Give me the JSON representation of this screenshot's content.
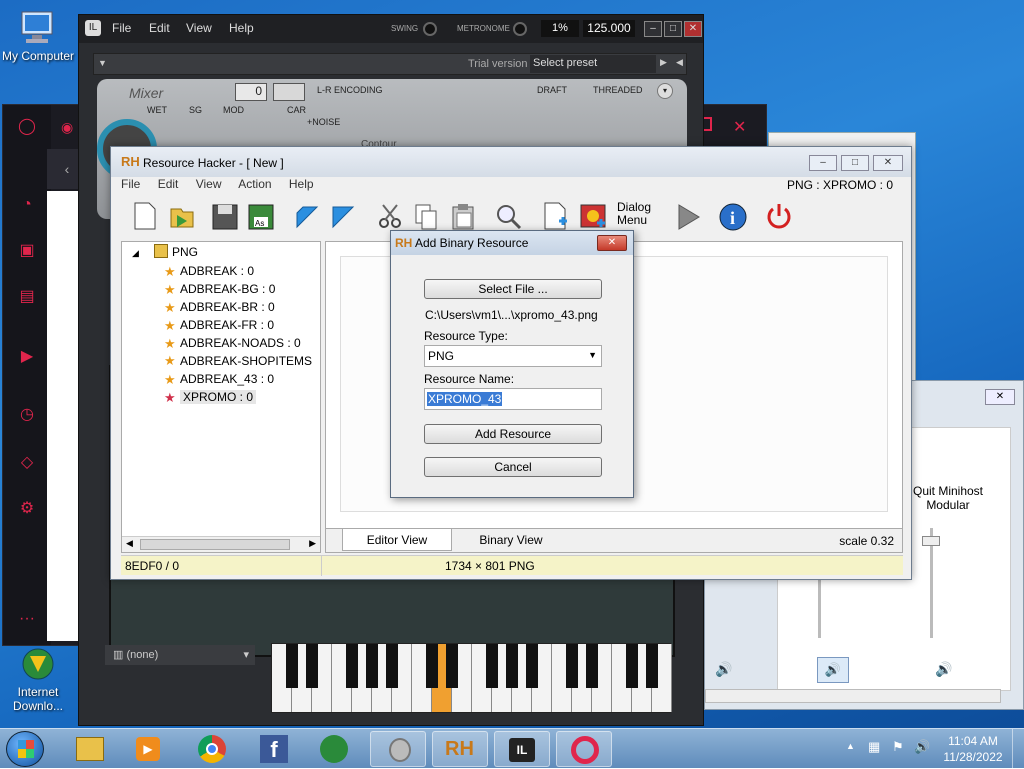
{
  "desktop": {
    "icons": [
      {
        "label": "My Computer"
      },
      {
        "label": "Internet Downlo..."
      }
    ]
  },
  "minihost": {
    "menu": [
      "File",
      "Edit",
      "View",
      "Help"
    ],
    "swing_label": "SWING",
    "metronome_label": "METRONOME",
    "percent": "1%",
    "tempo": "125.000",
    "trial_label": "Trial version",
    "preset_placeholder": "Select preset",
    "mixer_title": "Mixer",
    "wet": "WET",
    "sg": "SG",
    "mod": "MOD",
    "car": "CAR",
    "noise": "+NOISE",
    "mixer_value": "0",
    "lr_encoding": "L-R ENCODING",
    "draft": "DRAFT",
    "threaded": "THREADED",
    "contour": "Contour",
    "instrument_select": "(none)"
  },
  "minihost_side": {
    "quit_label": "Quit Minihost Modular"
  },
  "resource_hacker": {
    "title": "Resource Hacker - [ New ]",
    "menu": [
      "File",
      "Edit",
      "View",
      "Action",
      "Help"
    ],
    "current_resource": "PNG : XPROMO : 0",
    "dialog_menu_label_1": "Dialog",
    "dialog_menu_label_2": "Menu",
    "tree_root": "PNG",
    "tree_items": [
      {
        "label": "ADBREAK : 0"
      },
      {
        "label": "ADBREAK-BG : 0"
      },
      {
        "label": "ADBREAK-BR : 0"
      },
      {
        "label": "ADBREAK-FR : 0"
      },
      {
        "label": "ADBREAK-NOADS : 0"
      },
      {
        "label": "ADBREAK-SHOPITEMS"
      },
      {
        "label": "ADBREAK_43 : 0"
      },
      {
        "label": "XPROMO : 0"
      }
    ],
    "tab_editor": "Editor View",
    "tab_binary": "Binary View",
    "scale": "scale 0.32",
    "status_left": "8EDF0 / 0",
    "status_right": "1734 × 801  PNG"
  },
  "dialog": {
    "title": "Add Binary Resource",
    "select_file": "Select File ...",
    "file_path": "C:\\Users\\vm1\\...\\xpromo_43.png",
    "resource_type_label": "Resource Type:",
    "resource_type_value": "PNG",
    "resource_name_label": "Resource Name:",
    "resource_name_value": "XPROMO_43",
    "add_resource": "Add Resource",
    "cancel": "Cancel"
  },
  "taskbar": {
    "time": "11:04 AM",
    "date": "11/28/2022"
  }
}
